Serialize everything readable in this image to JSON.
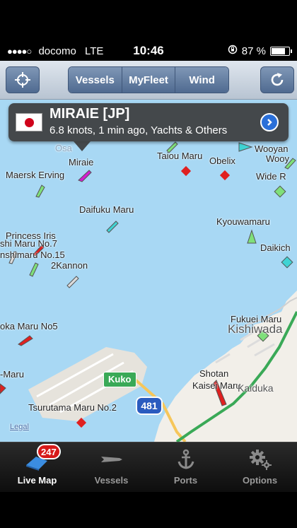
{
  "status_bar": {
    "signal": "●●●●○",
    "carrier": "docomo",
    "network": "LTE",
    "time": "10:46",
    "battery": "87 %",
    "battery_level": 0.87
  },
  "navbar": {
    "segments": [
      "Vessels",
      "MyFleet",
      "Wind"
    ],
    "active_segment": 0
  },
  "callout": {
    "title": "MIRAIE [JP]",
    "subtitle": "6.8 knots, 1 min ago, Yachts & Others",
    "flag": "japan-flag"
  },
  "map": {
    "labels": {
      "osaka": "Osa",
      "miraie": "Miraie",
      "maersk": "Maersk Erving",
      "taiou": "Taiou Maru",
      "obelix": "Obelix",
      "wooyang1": "Wooyan",
      "wooyang2": "Wooy",
      "wide": "Wide R",
      "daifuku": "Daifuku Maru",
      "kyouwamaru": "Kyouwamaru",
      "daikichi": "Daikich",
      "princess": "Princess Iris",
      "shimaru7": "shi Maru No.7",
      "inshimaru15": "nshimaru No.15",
      "tsurukannon": "2Kannon",
      "fukuei": "Fukuei Maru",
      "kishiwada": "Kishiwada",
      "oka": "oka Maru No5",
      "smaru": "-Maru",
      "shotan1": "Shotan",
      "shotan2": "Kaisei Maru",
      "kaiduka": "Kaiduka",
      "tsurutama": "Tsurutama Maru No.2",
      "legal": "Legal",
      "kuko_sign": "Kuko",
      "route_shield": "481"
    }
  },
  "tabbar": {
    "tabs": [
      {
        "label": "Live Map",
        "icon": "map-icon",
        "badge": "247"
      },
      {
        "label": "Vessels",
        "icon": "vessel-icon"
      },
      {
        "label": "Ports",
        "icon": "anchor-icon"
      },
      {
        "label": "Options",
        "icon": "gears-icon"
      }
    ],
    "active": 0
  },
  "colors": {
    "sea": "#a8d8f4",
    "land": "#f2efe9",
    "accent_blue": "#2a6fd8",
    "badge_red": "#d61a1a",
    "route_green": "#3aa957"
  }
}
